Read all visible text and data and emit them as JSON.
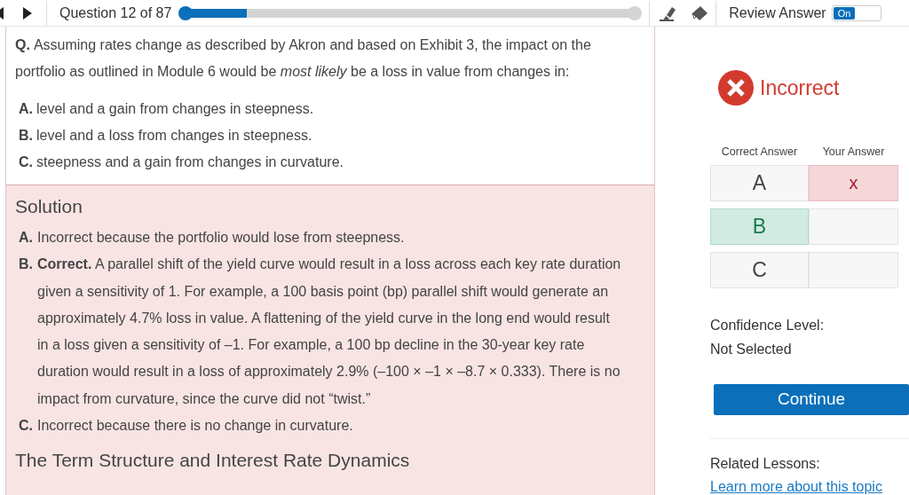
{
  "toolbar": {
    "question_counter": "Question 12 of 87",
    "progress": {
      "level": 0.14
    },
    "review_label": "Review Answer",
    "review_toggle": {
      "label": "On",
      "on": true
    }
  },
  "question": {
    "prefix": "Q.",
    "text": "Assuming rates change as described by Akron and based on Exhibit 3, the impact on the portfolio as outlined in Module 6 would be *most likely* be a loss in value from changes in:",
    "options": [
      {
        "label": "A.",
        "text": "level and a gain from changes in steepness."
      },
      {
        "label": "B.",
        "text": "level and a loss from changes in steepness."
      },
      {
        "label": "C.",
        "text": "steepness and a gain from changes in curvature."
      }
    ]
  },
  "solution": {
    "title": "Solution",
    "items": [
      {
        "label": "A.",
        "text": "Incorrect because the portfolio would lose from steepness."
      },
      {
        "label": "B.",
        "text": "**Correct.** A parallel shift of the yield curve would result in a loss across each key rate duration given a sensitivity of 1. For example, a 100 basis point (bp) parallel shift would generate an approximately 4.7% loss in value. A flattening of the yield curve in the long end would result in a loss given a sensitivity of –1. For example, a 100 bp decline in the 30-year key rate duration would result in a loss of approximately 2.9% (–100 × –1 × –8.7 × 0.333). There is no impact from curvature, since the curve did not “twist.”"
      },
      {
        "label": "C.",
        "text": "Incorrect because there is no change in curvature."
      }
    ],
    "topic": "The Term Structure and Interest Rate Dynamics"
  },
  "result": {
    "status": "Incorrect",
    "correct": false,
    "columns": [
      "Correct Answer",
      "Your Answer"
    ],
    "rows": [
      {
        "letter": "A",
        "correct": false,
        "your_mark": "x",
        "selected": true
      },
      {
        "letter": "B",
        "correct": true,
        "selected": false
      },
      {
        "letter": "C",
        "correct": false,
        "selected": false
      }
    ],
    "confidence_label": "Confidence Level:",
    "confidence_value": "Not Selected",
    "continue": "Continue",
    "related_label": "Related Lessons:",
    "related_link": "Learn more about this topic"
  }
}
